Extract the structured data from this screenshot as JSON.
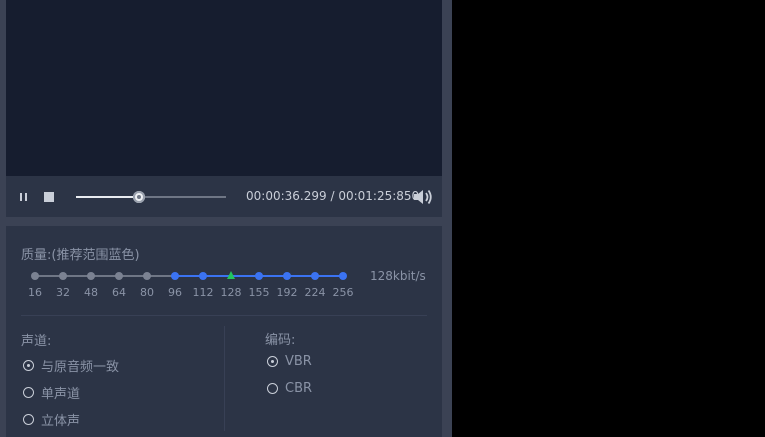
{
  "player": {
    "current_time": "00:00:36.299",
    "separator": "/",
    "total_time": "00:01:25:850",
    "progress": 0.42
  },
  "quality": {
    "label": "质量:(推荐范围蓝色)",
    "ticks": [
      "16",
      "32",
      "48",
      "64",
      "80",
      "96",
      "112",
      "128",
      "155",
      "192",
      "224",
      "256"
    ],
    "selected_index": 7,
    "recommended_from_index": 5,
    "value": "128kbit/s"
  },
  "channel": {
    "label": "声道:",
    "options": [
      "与原音频一致",
      "单声道",
      "立体声"
    ],
    "selected": 0
  },
  "encoding": {
    "label": "编码:",
    "options": [
      "VBR",
      "CBR"
    ],
    "selected": 0
  },
  "colors": {
    "recommended": "#3b73f2",
    "selected_marker": "#22c55e",
    "wave_start": "#1fb8c9",
    "wave_end": "#3fcf2e"
  }
}
